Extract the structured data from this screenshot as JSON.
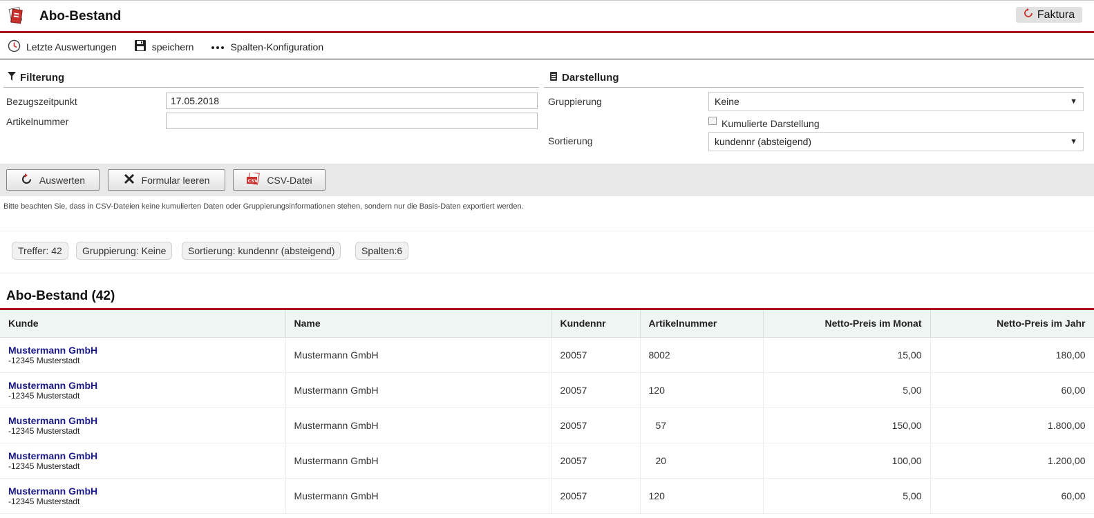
{
  "header": {
    "title": "Abo-Bestand",
    "faktura_label": "Faktura"
  },
  "toolbar": {
    "recent_label": "Letzte Auswertungen",
    "save_label": "speichern",
    "columns_label": "Spalten-Konfiguration"
  },
  "filter": {
    "title": "Filterung",
    "date_label": "Bezugszeitpunkt",
    "date_value": "17.05.2018",
    "article_label": "Artikelnummer",
    "article_value": ""
  },
  "display": {
    "title": "Darstellung",
    "group_label": "Gruppierung",
    "group_value": "Keine",
    "cumulative_label": "Kumulierte Darstellung",
    "sort_label": "Sortierung",
    "sort_value": "kundennr (absteigend)"
  },
  "actions": {
    "evaluate": "Auswerten",
    "clear": "Formular leeren",
    "csv": "CSV-Datei"
  },
  "note": "Bitte beachten Sie, dass in CSV-Dateien keine kumulierten Daten oder Gruppierungsinformationen stehen, sondern nur die Basis-Daten exportiert werden.",
  "chips": [
    "Treffer: 42",
    "Gruppierung: Keine",
    "Sortierung: kundennr (absteigend)",
    "Spalten:6"
  ],
  "table": {
    "title": "Abo-Bestand (42)",
    "columns": [
      "Kunde",
      "Name",
      "Kundennr",
      "Artikelnummer",
      "Netto-Preis im Monat",
      "Netto-Preis im Jahr"
    ],
    "rows": [
      {
        "kunde": "Mustermann GmbH",
        "ort": "-12345 Musterstadt",
        "name": "Mustermann GmbH",
        "kundennr": "20057",
        "artikel": "8002",
        "monat": "15,00",
        "jahr": "180,00"
      },
      {
        "kunde": "Mustermann GmbH",
        "ort": "-12345 Musterstadt",
        "name": "Mustermann GmbH",
        "kundennr": "20057",
        "artikel": "120",
        "monat": "5,00",
        "jahr": "60,00"
      },
      {
        "kunde": "Mustermann GmbH",
        "ort": "-12345 Musterstadt",
        "name": "Mustermann GmbH",
        "kundennr": "20057",
        "artikel": "57",
        "monat": "150,00",
        "jahr": "1.800,00"
      },
      {
        "kunde": "Mustermann GmbH",
        "ort": "-12345 Musterstadt",
        "name": "Mustermann GmbH",
        "kundennr": "20057",
        "artikel": "20",
        "monat": "100,00",
        "jahr": "1.200,00"
      },
      {
        "kunde": "Mustermann GmbH",
        "ort": "-12345 Musterstadt",
        "name": "Mustermann GmbH",
        "kundennr": "20057",
        "artikel": "120",
        "monat": "5,00",
        "jahr": "60,00"
      }
    ]
  },
  "colors": {
    "accent_red": "#a4161a",
    "link_blue": "#1a1a8c",
    "header_bg": "#eef5f3"
  },
  "icons": [
    "app-logo-icon",
    "refresh-icon",
    "clock-icon",
    "floppy-disk-icon",
    "dots-icon",
    "filter-icon",
    "document-icon",
    "close-x-icon",
    "csv-file-icon",
    "chevron-down-icon"
  ]
}
